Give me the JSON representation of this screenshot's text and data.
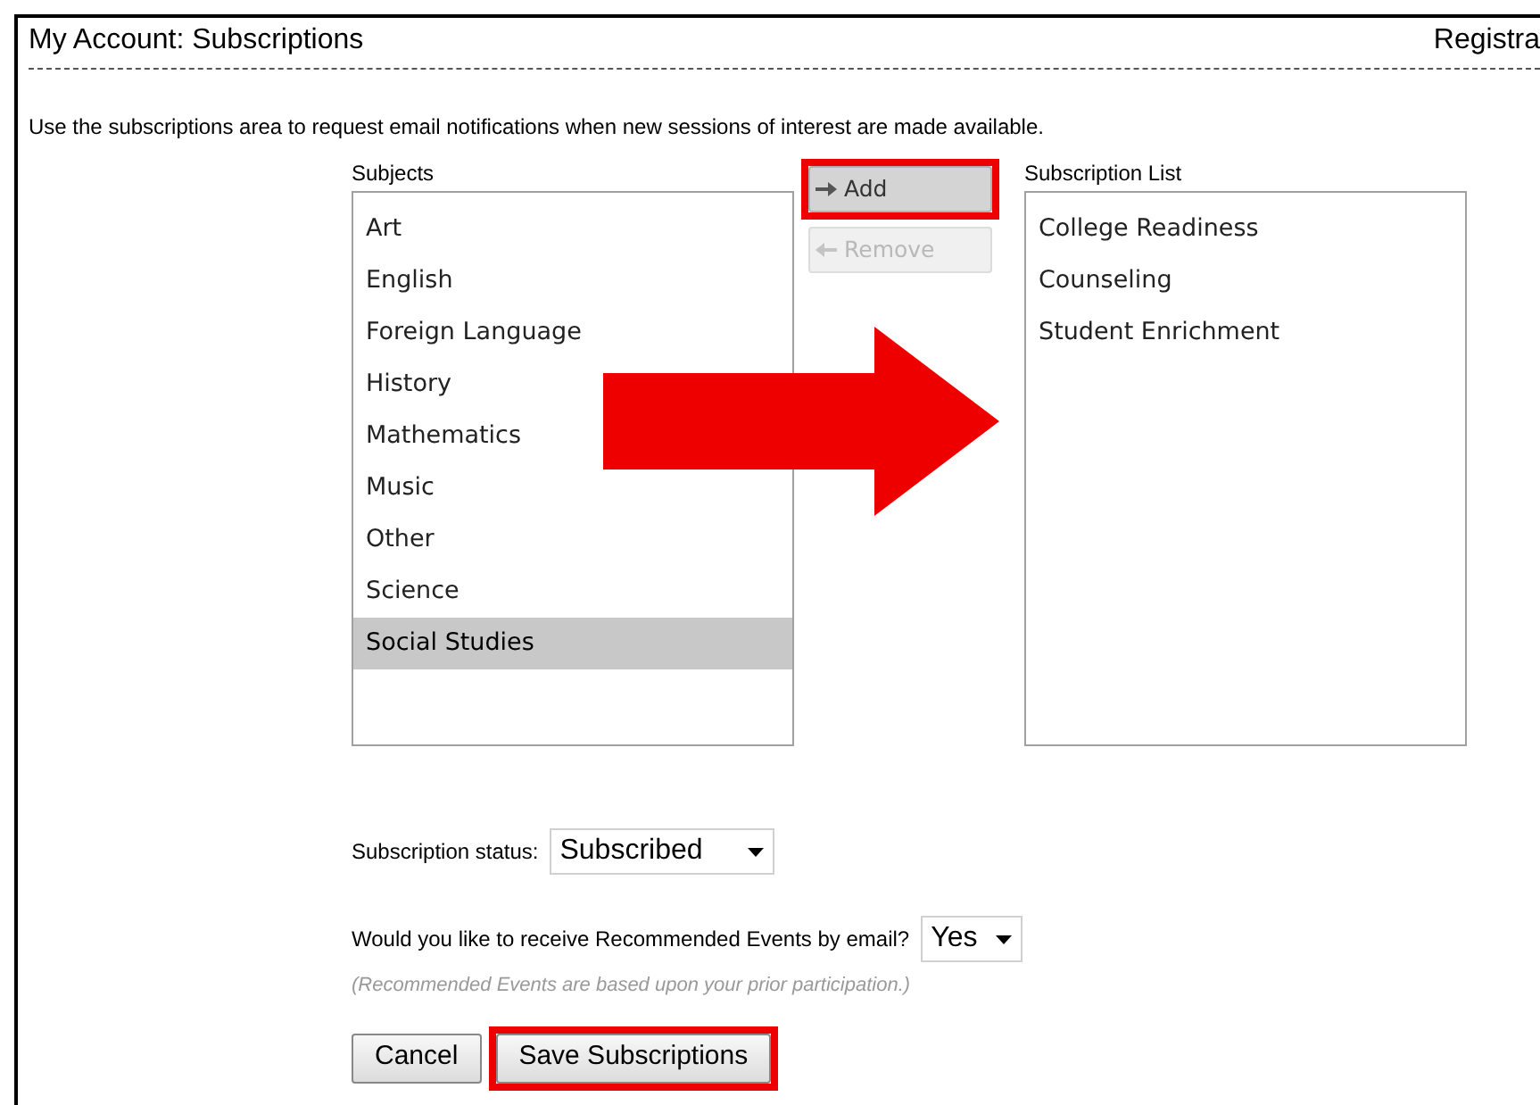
{
  "header": {
    "title": "My Account: Subscriptions",
    "right_text": "Registra"
  },
  "intro": "Use the subscriptions area to request email notifications when new sessions of interest are made available.",
  "subjects": {
    "label": "Subjects",
    "items": [
      {
        "label": "Art",
        "selected": false
      },
      {
        "label": "English",
        "selected": false
      },
      {
        "label": "Foreign Language",
        "selected": false
      },
      {
        "label": "History",
        "selected": false
      },
      {
        "label": "Mathematics",
        "selected": false
      },
      {
        "label": "Music",
        "selected": false
      },
      {
        "label": "Other",
        "selected": false
      },
      {
        "label": "Science",
        "selected": false
      },
      {
        "label": "Social Studies",
        "selected": true
      }
    ]
  },
  "actions": [
    {
      "label": "Add",
      "kind": "add",
      "disabled": false,
      "highlighted": true
    },
    {
      "label": "Remove",
      "kind": "remove",
      "disabled": true,
      "highlighted": false
    }
  ],
  "subscription_list": {
    "label": "Subscription List",
    "items": [
      {
        "label": "College Readiness",
        "selected": false
      },
      {
        "label": "Counseling",
        "selected": false
      },
      {
        "label": "Student Enrichment",
        "selected": false
      }
    ]
  },
  "status": {
    "label": "Subscription status:",
    "value": "Subscribed"
  },
  "recommended": {
    "label": "Would you like to receive Recommended Events by email?",
    "value": "Yes",
    "note": "(Recommended Events are based upon your prior participation.)"
  },
  "buttons": [
    {
      "label": "Cancel",
      "highlighted": false
    },
    {
      "label": "Save Subscriptions",
      "highlighted": true
    }
  ]
}
